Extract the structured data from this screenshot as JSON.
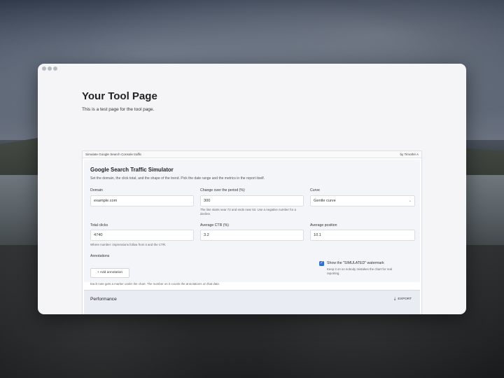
{
  "page": {
    "title": "Your Tool Page",
    "subtitle": "This is a test page for the tool page."
  },
  "panel": {
    "header_left": "Simulate Google Search Console traffic",
    "header_right": "by Timothé A",
    "sim_title": "Google Search Traffic Simulator",
    "sim_desc": "Set the domain, the click total, and the shape of the trend. Pick the date range and the metrics in the report itself."
  },
  "fields": {
    "domain": {
      "label": "Domain",
      "value": "example.com"
    },
    "change": {
      "label": "Change over the period (%)",
      "value": "300",
      "hint": "The line starts near 72 and ends near 53. Use a negative number for a decline."
    },
    "curve": {
      "label": "Curve",
      "value": "Gentle curve"
    },
    "clicks": {
      "label": "Total clicks",
      "value": "4740",
      "hint": "Where number: impressions follow from it and the CTR."
    },
    "ctr": {
      "label": "Average CTR (%)",
      "value": "3.2"
    },
    "position": {
      "label": "Average position",
      "value": "10.1"
    }
  },
  "annotations": {
    "label": "Annotations",
    "add_button": "+ Add annotation",
    "hint": "Each note gets a marker under the chart. The number on it counts the annotations on that date."
  },
  "watermark": {
    "label": "Show the \"SIMULATED\" watermark",
    "checked": true,
    "hint_line1": "Keep it on so nobody mistakes the chart for real",
    "hint_line2": "reporting."
  },
  "performance": {
    "title": "Performance",
    "export_label": "EXPORT",
    "export_icon": "download-icon"
  },
  "colors": {
    "accent": "#2f6fdc"
  }
}
